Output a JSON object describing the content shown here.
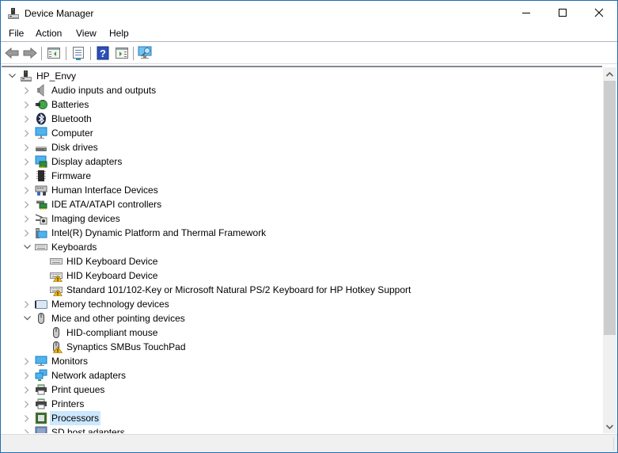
{
  "window": {
    "title": "Device Manager",
    "controls": [
      "minimize",
      "maximize",
      "close"
    ]
  },
  "menu": {
    "items": [
      "File",
      "Action",
      "View",
      "Help"
    ]
  },
  "toolbar": {
    "buttons": [
      {
        "name": "back-button",
        "icon": "arrow-left-icon",
        "enabled": false
      },
      {
        "name": "forward-button",
        "icon": "arrow-right-icon",
        "enabled": false
      },
      {
        "name": "show-hide-console-tree-button",
        "icon": "console-tree-icon"
      },
      {
        "name": "properties-button",
        "icon": "properties-icon"
      },
      {
        "name": "help-button",
        "icon": "help-icon"
      },
      {
        "name": "show-action-pane-button",
        "icon": "action-pane-icon"
      },
      {
        "name": "scan-hardware-button",
        "icon": "monitor-search-icon"
      }
    ]
  },
  "tree": {
    "root": {
      "label": "HP_Envy",
      "expanded": true,
      "icon": "computer-tower-icon"
    },
    "items": [
      {
        "label": "Audio inputs and outputs",
        "level": 1,
        "state": "collapsed",
        "icon": "speaker-icon"
      },
      {
        "label": "Batteries",
        "level": 1,
        "state": "collapsed",
        "icon": "battery-icon"
      },
      {
        "label": "Bluetooth",
        "level": 1,
        "state": "collapsed",
        "icon": "bluetooth-icon"
      },
      {
        "label": "Computer",
        "level": 1,
        "state": "collapsed",
        "icon": "computer-icon"
      },
      {
        "label": "Disk drives",
        "level": 1,
        "state": "collapsed",
        "icon": "disk-drive-icon"
      },
      {
        "label": "Display adapters",
        "level": 1,
        "state": "collapsed",
        "icon": "display-adapter-icon"
      },
      {
        "label": "Firmware",
        "level": 1,
        "state": "collapsed",
        "icon": "firmware-chip-icon"
      },
      {
        "label": "Human Interface Devices",
        "level": 1,
        "state": "collapsed",
        "icon": "hid-icon"
      },
      {
        "label": "IDE ATA/ATAPI controllers",
        "level": 1,
        "state": "collapsed",
        "icon": "ide-controller-icon"
      },
      {
        "label": "Imaging devices",
        "level": 1,
        "state": "collapsed",
        "icon": "camera-icon"
      },
      {
        "label": "Intel(R) Dynamic Platform and Thermal Framework",
        "level": 1,
        "state": "collapsed",
        "icon": "system-device-icon"
      },
      {
        "label": "Keyboards",
        "level": 1,
        "state": "expanded",
        "icon": "keyboard-icon"
      },
      {
        "label": "HID Keyboard Device",
        "level": 2,
        "state": "leaf",
        "icon": "keyboard-icon",
        "warning": false
      },
      {
        "label": "HID Keyboard Device",
        "level": 2,
        "state": "leaf",
        "icon": "keyboard-icon",
        "warning": true
      },
      {
        "label": "Standard 101/102-Key or Microsoft Natural PS/2 Keyboard for HP Hotkey Support",
        "level": 2,
        "state": "leaf",
        "icon": "keyboard-icon",
        "warning": true
      },
      {
        "label": "Memory technology devices",
        "level": 1,
        "state": "collapsed",
        "icon": "memory-device-icon"
      },
      {
        "label": "Mice and other pointing devices",
        "level": 1,
        "state": "expanded",
        "icon": "mouse-icon"
      },
      {
        "label": "HID-compliant mouse",
        "level": 2,
        "state": "leaf",
        "icon": "mouse-icon",
        "warning": false
      },
      {
        "label": "Synaptics SMBus TouchPad",
        "level": 2,
        "state": "leaf",
        "icon": "mouse-icon",
        "warning": true
      },
      {
        "label": "Monitors",
        "level": 1,
        "state": "collapsed",
        "icon": "monitor-icon"
      },
      {
        "label": "Network adapters",
        "level": 1,
        "state": "collapsed",
        "icon": "network-adapter-icon"
      },
      {
        "label": "Print queues",
        "level": 1,
        "state": "collapsed",
        "icon": "printer-icon"
      },
      {
        "label": "Printers",
        "level": 1,
        "state": "collapsed",
        "icon": "printer-icon"
      },
      {
        "label": "Processors",
        "level": 1,
        "state": "collapsed",
        "icon": "processor-icon",
        "selected": true
      },
      {
        "label": "SD host adapters",
        "level": 1,
        "state": "collapsed",
        "icon": "sd-host-icon"
      }
    ]
  },
  "scrollbar": {
    "position_fraction": 0.0,
    "visible_fraction": 0.75
  },
  "statusbar": {
    "text": ""
  },
  "colors": {
    "window_border": "#1f6fb4",
    "selection": "#cce8ff",
    "warning": "#f5b800"
  }
}
